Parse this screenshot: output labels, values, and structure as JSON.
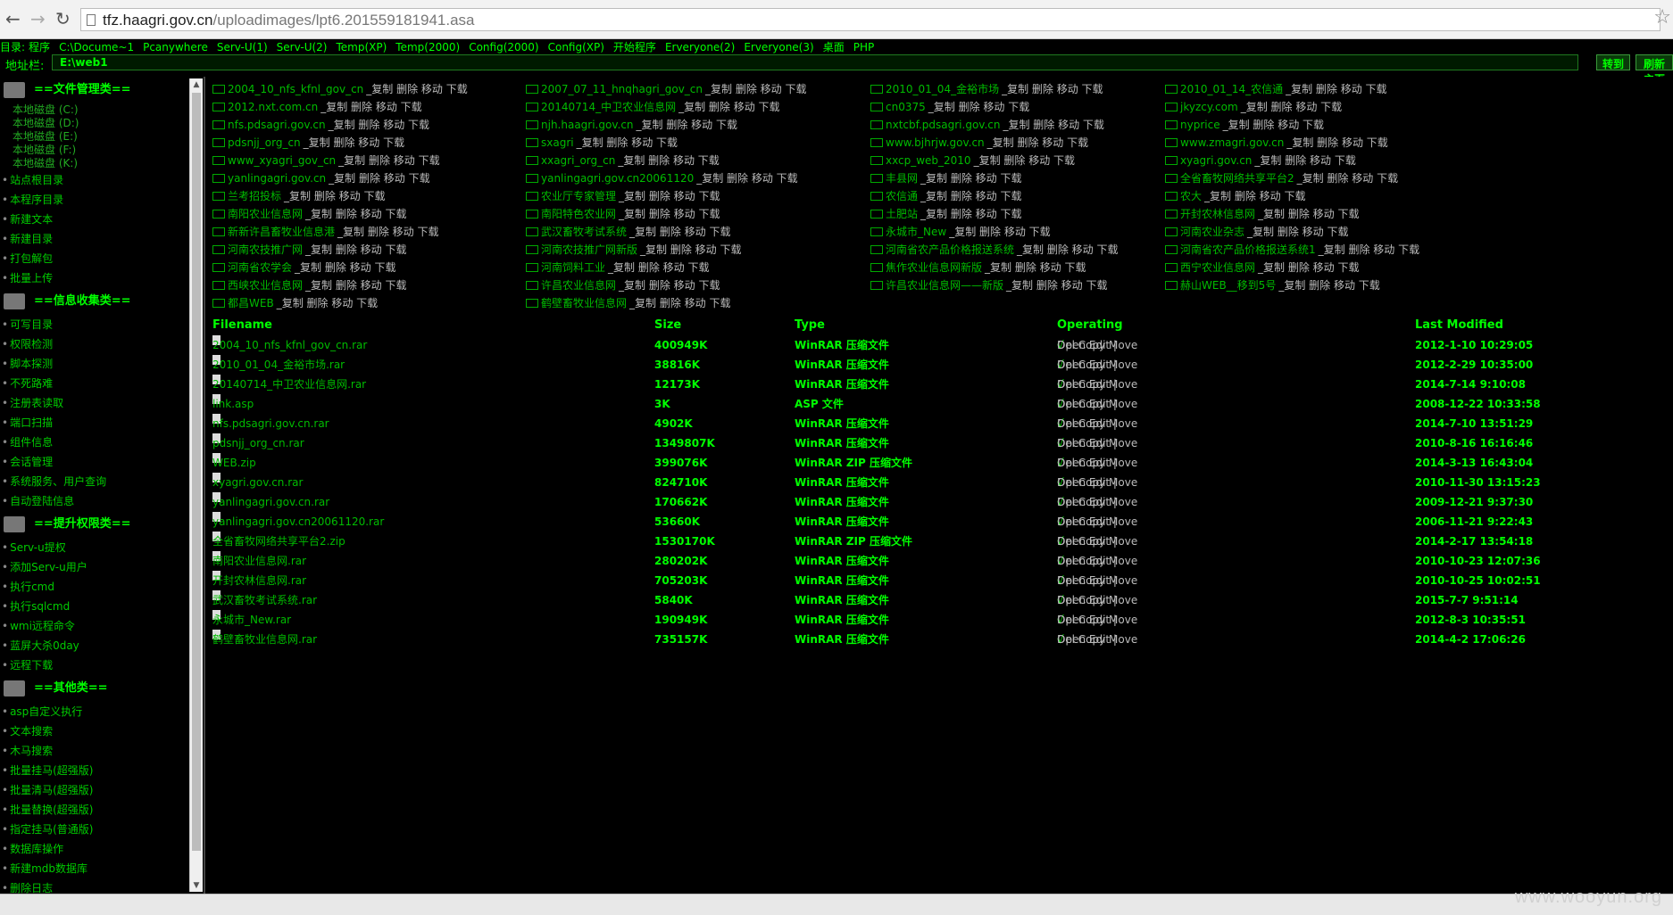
{
  "browser": {
    "url_host": "tfz.haagri.gov.cn",
    "url_path": "/uploadimages/lpt6.201559181941.asa"
  },
  "dirbar": {
    "label": "目录:",
    "links": [
      "程序",
      "C:\\Docume~1",
      "Pcanywhere",
      "Serv-U(1)",
      "Serv-U(2)",
      "Temp(XP)",
      "Temp(2000)",
      "Config(2000)",
      "Config(XP)",
      "开始程序",
      "Erveryone(2)",
      "Erveryone(3)",
      "桌面",
      "PHP"
    ]
  },
  "address": {
    "label": "地址栏:",
    "value": "E:\\web1",
    "go_label": "转到",
    "refresh_label": "刷新主页"
  },
  "sidebar": {
    "sections": [
      {
        "title": "==文件管理类==",
        "subs": [
          "本地磁盘 (C:)",
          "本地磁盘 (D:)",
          "本地磁盘 (E:)",
          "本地磁盘 (F:)",
          "本地磁盘 (K:)"
        ],
        "items": [
          "站点根目录",
          "本程序目录",
          "新建文本",
          "新建目录",
          "打包解包",
          "批量上传"
        ]
      },
      {
        "title": "==信息收集类==",
        "subs": [],
        "items": [
          "可写目录",
          "权限检测",
          "脚本探测",
          "不死路难",
          "注册表读取",
          "端口扫描",
          "组件信息",
          "会话管理",
          "系统服务、用户查询",
          "自动登陆信息"
        ]
      },
      {
        "title": "==提升权限类==",
        "subs": [],
        "items": [
          "Serv-u提权",
          "添加Serv-u用户",
          "执行cmd",
          "执行sqlcmd",
          "wmi远程命令",
          "蓝屏大杀0day",
          "远程下载"
        ]
      },
      {
        "title": "==其他类==",
        "subs": [],
        "items": [
          "asp自定义执行",
          "文本搜索",
          "木马搜索",
          "批量挂马(超强版)",
          "批量清马(超强版)",
          "批量替换(超强版)",
          "指定挂马(普通版)",
          "数据库操作",
          "新建mdb数据库",
          "删除日志"
        ]
      }
    ]
  },
  "folder_ops": "_复制 删除 移动 下载",
  "folders": [
    [
      "2004_10_nfs_kfnl_gov_cn",
      "2007_07_11_hnqhagri_gov_cn",
      "2010_01_04_金裕市场",
      "2010_01_14_农信通"
    ],
    [
      "2012.nxt.com.cn",
      "20140714_中卫农业信息网",
      "cn0375",
      "jkyzcy.com"
    ],
    [
      "nfs.pdsagri.gov.cn",
      "njh.haagri.gov.cn",
      "nxtcbf.pdsagri.gov.cn",
      "nyprice"
    ],
    [
      "pdsnjj_org_cn",
      "sxagri",
      "www.bjhrjw.gov.cn",
      "www.zmagri.gov.cn"
    ],
    [
      "www_xyagri_gov_cn",
      "xxagri_org_cn",
      "xxcp_web_2010",
      "xyagri.gov.cn"
    ],
    [
      "yanlingagri.gov.cn",
      "yanlingagri.gov.cn20061120",
      "丰县网",
      "全省畜牧网络共享平台2"
    ],
    [
      "兰考招投标",
      "农业厅专家管理",
      "农信通",
      "农大"
    ],
    [
      "南阳农业信息网",
      "南阳特色农业网",
      "土肥站",
      "开封农林信息网"
    ],
    [
      "新新许昌畜牧业信息港",
      "武汉畜牧考试系统",
      "永城市_New",
      "河南农业杂志"
    ],
    [
      "河南农技推广网",
      "河南农技推广网新版",
      "河南省农产品价格报送系统",
      "河南省农产品价格报送系统1"
    ],
    [
      "河南省农学会",
      "河南饲料工业",
      "焦作农业信息网新版",
      "西宁农业信息网"
    ],
    [
      "西峡农业信息网",
      "许昌农业信息网",
      "许昌农业信息网——新版",
      "赫山WEB__移到5号"
    ],
    [
      "都昌WEB",
      "鹤壁畜牧业信息网",
      "",
      ""
    ]
  ],
  "table": {
    "headers": [
      "Filename",
      "Size",
      "Type",
      "Operating",
      "Last Modified"
    ],
    "op_text_a": "Open Edit |",
    "op_check": "√",
    "op_text_b": " Del Copy Move",
    "rows": [
      [
        "2004_10_nfs_kfnl_gov_cn.rar",
        "400949K",
        "WinRAR 压缩文件",
        "2012-1-10 10:29:05"
      ],
      [
        "2010_01_04_金裕市场.rar",
        "38816K",
        "WinRAR 压缩文件",
        "2012-2-29 10:35:00"
      ],
      [
        "20140714_中卫农业信息网.rar",
        "12173K",
        "WinRAR 压缩文件",
        "2014-7-14 9:10:08"
      ],
      [
        "link.asp",
        "3K",
        "ASP 文件",
        "2008-12-22 10:33:58"
      ],
      [
        "nfs.pdsagri.gov.cn.rar",
        "4902K",
        "WinRAR 压缩文件",
        "2014-7-10 13:51:29"
      ],
      [
        "pdsnjj_org_cn.rar",
        "1349807K",
        "WinRAR 压缩文件",
        "2010-8-16 16:16:46"
      ],
      [
        "WEB.zip",
        "399076K",
        "WinRAR ZIP 压缩文件",
        "2014-3-13 16:43:04"
      ],
      [
        "xyagri.gov.cn.rar",
        "824710K",
        "WinRAR 压缩文件",
        "2010-11-30 13:15:23"
      ],
      [
        "yanlingagri.gov.cn.rar",
        "170662K",
        "WinRAR 压缩文件",
        "2009-12-21 9:37:30"
      ],
      [
        "yanlingagri.gov.cn20061120.rar",
        "53660K",
        "WinRAR 压缩文件",
        "2006-11-21 9:22:43"
      ],
      [
        "全省畜牧网络共享平台2.zip",
        "1530170K",
        "WinRAR ZIP 压缩文件",
        "2014-2-17 13:54:18"
      ],
      [
        "南阳农业信息网.rar",
        "280202K",
        "WinRAR 压缩文件",
        "2010-10-23 12:07:36"
      ],
      [
        "开封农林信息网.rar",
        "705203K",
        "WinRAR 压缩文件",
        "2010-10-25 10:02:51"
      ],
      [
        "武汉畜牧考试系统.rar",
        "5840K",
        "WinRAR 压缩文件",
        "2015-7-7 9:51:14"
      ],
      [
        "永城市_New.rar",
        "190949K",
        "WinRAR 压缩文件",
        "2012-8-3 10:35:51"
      ],
      [
        "鹤壁畜牧业信息网.rar",
        "735157K",
        "WinRAR 压缩文件",
        "2014-4-2 17:06:26"
      ]
    ]
  },
  "watermark": "www.wooyun.org"
}
